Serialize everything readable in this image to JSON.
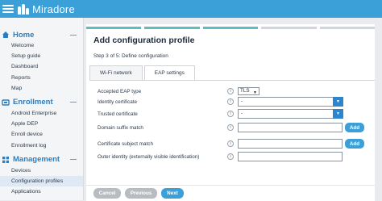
{
  "app": {
    "name": "Miradore"
  },
  "sidebar": {
    "home": {
      "title": "Home",
      "items": [
        "Welcome",
        "Setup guide",
        "Dashboard",
        "Reports",
        "Map"
      ]
    },
    "enrollment": {
      "title": "Enrollment",
      "items": [
        "Android Enterprise",
        "Apple DEP",
        "Enroll device",
        "Enrollment log"
      ]
    },
    "management": {
      "title": "Management",
      "items": [
        "Devices",
        "Configuration profiles",
        "Applications"
      ],
      "active": "Configuration profiles"
    }
  },
  "wizard": {
    "title": "Add configuration profile",
    "step": "Step 3 of 5: Define configuration",
    "progress_done": 3,
    "progress_total": 5,
    "tabs": [
      "Wi-Fi network",
      "EAP settings"
    ],
    "active_tab": "EAP settings"
  },
  "form": {
    "eap_type": {
      "label": "Accepted EAP type",
      "value": "TLS"
    },
    "identity_certificate": {
      "label": "Identity certificate",
      "value": "-"
    },
    "trusted_certificate": {
      "label": "Trusted certificate",
      "value": "-"
    },
    "domain_suffix": {
      "label": "Domain suffix match",
      "value": "",
      "button": "Add"
    },
    "subject_match": {
      "label": "Certificate subject match",
      "value": "",
      "button": "Add"
    },
    "outer_identity": {
      "label": "Outer identity (externally visible identification)",
      "value": ""
    },
    "info_glyph": "i"
  },
  "footer": {
    "cancel": "Cancel",
    "previous": "Previous",
    "next": "Next"
  },
  "colors": {
    "topbar": "#3b9fd8",
    "accent": "#2c86cf",
    "progress_done": "#5bbfbf"
  }
}
